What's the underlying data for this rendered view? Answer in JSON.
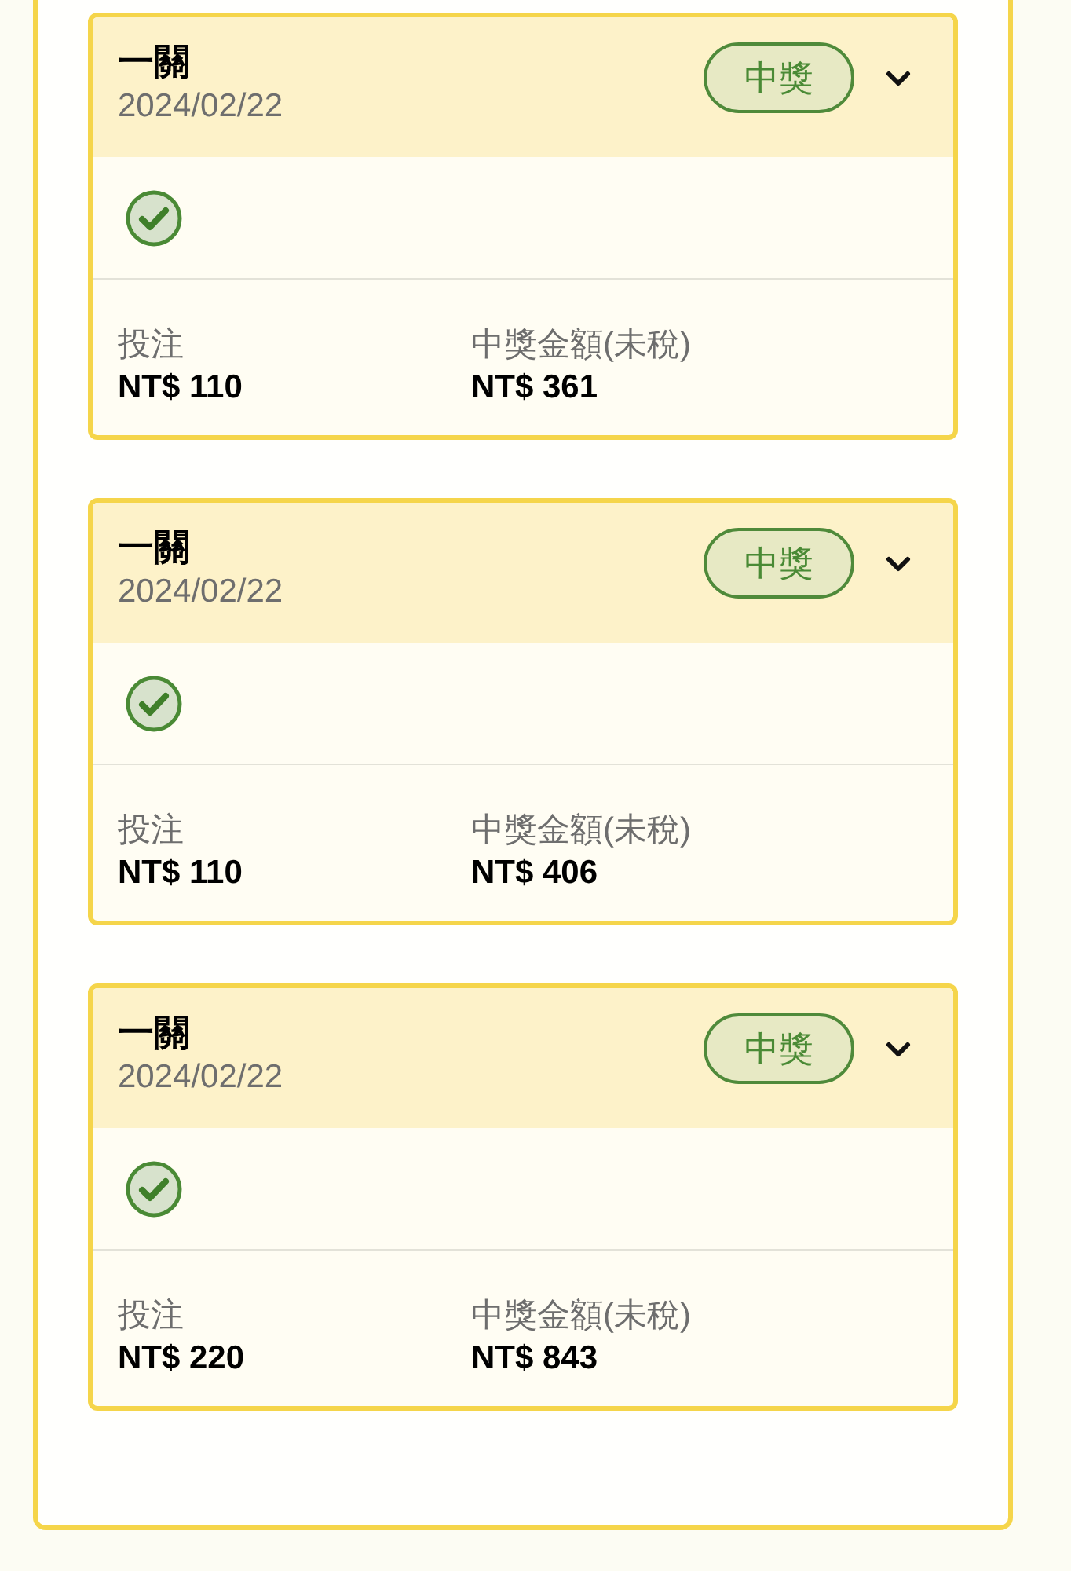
{
  "tickets": [
    {
      "title": "一關",
      "date": "2024/02/22",
      "badge": "中獎",
      "stake_label": "投注",
      "stake": "NT$ 110",
      "prize_label": "中獎金額(未稅)",
      "prize": "NT$ 361"
    },
    {
      "title": "一關",
      "date": "2024/02/22",
      "badge": "中獎",
      "stake_label": "投注",
      "stake": "NT$ 110",
      "prize_label": "中獎金額(未稅)",
      "prize": "NT$ 406"
    },
    {
      "title": "一關",
      "date": "2024/02/22",
      "badge": "中獎",
      "stake_label": "投注",
      "stake": "NT$ 220",
      "prize_label": "中獎金額(未稅)",
      "prize": "NT$ 843"
    }
  ]
}
